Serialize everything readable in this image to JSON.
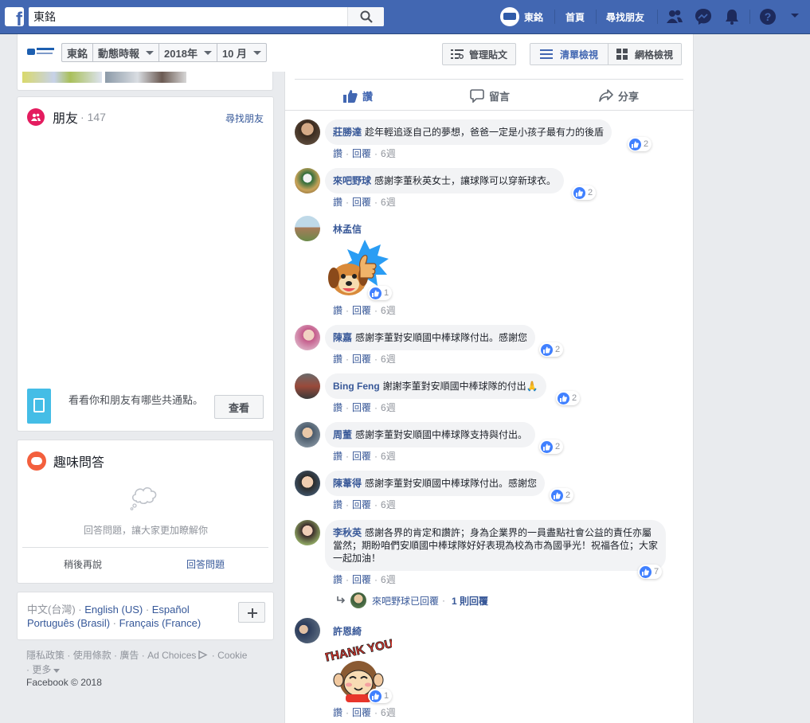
{
  "topbar": {
    "search_value": "東銘",
    "profile_name": "東銘",
    "home": "首頁",
    "find_friends": "尋找朋友"
  },
  "page_header": {
    "filter_name": "東銘",
    "filter_posts": "動態時報",
    "filter_year": "2018年",
    "filter_month": "10 月",
    "manage_posts": "管理貼文",
    "list_view": "清單檢視",
    "grid_view": "網格檢視"
  },
  "friends": {
    "title": "朋友",
    "count": "· 147",
    "find_link": "尋找朋友",
    "mutual_text": "看看你和朋友有哪些共通點。",
    "view_button": "查看"
  },
  "qa": {
    "title": "趣味問答",
    "prompt": "回答問題，讓大家更加瞭解你",
    "later": "稍後再說",
    "answer": "回答問題"
  },
  "languages": {
    "current": "中文(台灣)",
    "options": [
      "English (US)",
      "Español",
      "Português (Brasil)",
      "Français (France)"
    ]
  },
  "footer": {
    "links": [
      "隱私政策",
      "使用條款",
      "廣告",
      "Ad Choices",
      "Cookie",
      "更多"
    ],
    "copyright": "Facebook © 2018"
  },
  "actions": {
    "like": "讚",
    "comment": "留言",
    "share": "分享"
  },
  "comment_meta": {
    "like": "讚",
    "reply": "回覆"
  },
  "comments": [
    {
      "name": "莊勝達",
      "text": "趁年輕追逐自己的夢想，爸爸一定是小孩子最有力的後盾",
      "time": "6週",
      "likes": "2"
    },
    {
      "name": "來吧野球",
      "text": "感謝李董秋英女士，讓球隊可以穿新球衣。",
      "time": "6週",
      "likes": "2"
    },
    {
      "name": "林孟信",
      "text": "",
      "time": "6週",
      "likes": "1",
      "sticker": "dog-thumbs-up-sticker"
    },
    {
      "name": "陳嘉",
      "text": "感謝李董對安順國中棒球隊付出。感謝您",
      "time": "6週",
      "likes": "2"
    },
    {
      "name": "Bing Feng",
      "text": "謝謝李董對安順國中棒球隊的付出🙏",
      "time": "6週",
      "likes": "2"
    },
    {
      "name": "周董",
      "text": "感謝李董對安順國中棒球隊支持與付出。",
      "time": "6週",
      "likes": "2"
    },
    {
      "name": "陳葦得",
      "text": "感謝李董對安順國中棒球隊付出。感謝您",
      "time": "6週",
      "likes": "2"
    },
    {
      "name": "李秋英",
      "text": "感謝各界的肯定和讚許；身為企業界的一員盡點社會公益的責任亦屬當然；期盼咱們安順國中棒球隊好好表現為校為市為國爭光！祝福各位；大家一起加油！",
      "time": "6週",
      "likes": "7"
    },
    {
      "name": "許恩綺",
      "text": "",
      "time": "6週",
      "likes": "1",
      "sticker": "thank-you-monkey-sticker"
    }
  ],
  "reply_summary": {
    "replier": "來吧野球",
    "text": "已回覆",
    "count": "1 則回覆"
  },
  "sticker_text": "THANK YOU",
  "colors": {
    "topbar": "#4267b2",
    "link": "#385898",
    "like_blue": "#4080ff"
  }
}
